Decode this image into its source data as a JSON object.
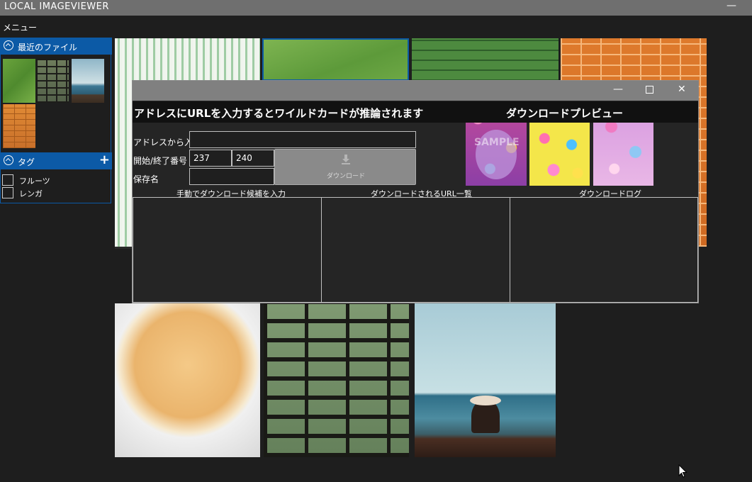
{
  "app": {
    "title": "LOCAL IMAGEVIEWER",
    "minimize_glyph": "—"
  },
  "menubar": {
    "menu_label": "メニュー"
  },
  "sidebar": {
    "recent_header": "最近のファイル",
    "recent_thumbs": [
      "green-texture",
      "green-brick",
      "beach-woman",
      "orange-brick"
    ],
    "tag_header": "タグ",
    "add_tag_glyph": "+",
    "tags": [
      {
        "label": "フルーツ",
        "checked": false
      },
      {
        "label": "レンガ",
        "checked": false
      }
    ]
  },
  "gallery": {
    "tiles": [
      "green-stripes",
      "green-paper",
      "green-wood",
      "orange-brick",
      "orange-slice",
      "green-brick",
      "beach-woman"
    ]
  },
  "dialog": {
    "heading": "アドレスにURLを入力するとワイルドカードが推論されます",
    "preview_title": "ダウンロードプレビュー",
    "address_label": "アドレスから入力",
    "address_value": "",
    "range_label": "開始/終了番号",
    "start_value": "237",
    "end_value": "240",
    "save_label": "保存名",
    "save_value": "",
    "download_button": "ダウンロード",
    "manual_label": "手動でダウンロード候補を入力",
    "url_list_label": "ダウンロードされるURL一覧",
    "log_label": "ダウンロードログ",
    "preview_images": [
      "flower-sample",
      "flower-yellow",
      "flower-pink"
    ],
    "preview_watermark": "SAMPLE"
  },
  "colors": {
    "accent": "#0c5aa6",
    "titlebar": "#6f6f6f",
    "dialog_title": "#808080"
  }
}
